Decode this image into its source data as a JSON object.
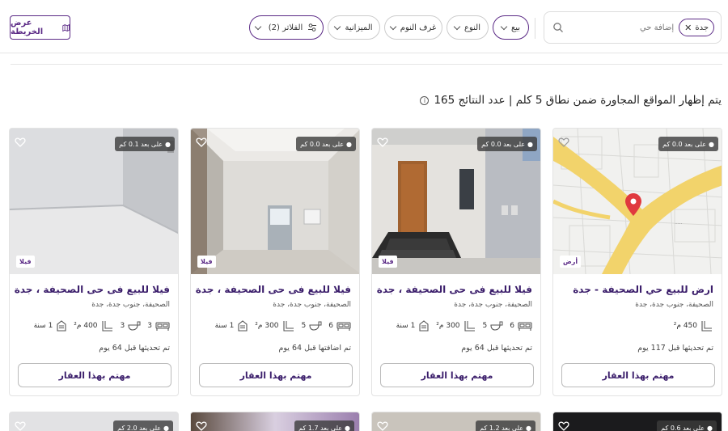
{
  "header": {
    "map_button": "عرض الخريطة",
    "search_chip": "جدة",
    "search_placeholder": "إضافة حي",
    "filters": [
      {
        "label": "بيع"
      },
      {
        "label": "النوع"
      },
      {
        "label": "غرف النوم"
      },
      {
        "label": "الميزانية"
      },
      {
        "label": "الفلاتر (2)"
      }
    ]
  },
  "results_text": "يتم إظهار المواقع المجاورة ضمن نطاق 5 كلم | عدد النتائج 165",
  "cards": [
    {
      "distance": "على بعد 0.0 كم",
      "type_badge": "أرض",
      "title": "ارض للبيع حي الصحيفة - جدة",
      "location": "الصحيفة، جنوب جدة، جدة",
      "area": "450 م²",
      "updated": "تم تحديثها قبل 117 يوم",
      "cta": "مهتم بهذا العقار"
    },
    {
      "distance": "على بعد 0.0 كم",
      "type_badge": "فيلا",
      "title": "فيلا للبيع فى حى الصحيفة ، جدة",
      "location": "الصحيفة، جنوب جدة، جدة",
      "beds": "6",
      "baths": "5",
      "area": "300 م²",
      "age": "1 سنة",
      "updated": "تم تحديثها قبل 64 يوم",
      "cta": "مهتم بهذا العقار"
    },
    {
      "distance": "على بعد 0.0 كم",
      "type_badge": "فيلا",
      "title": "فيلا للبيع فى حى الصحيفة ، جدة",
      "location": "الصحيفة، جنوب جدة، جدة",
      "beds": "6",
      "baths": "5",
      "area": "300 م²",
      "age": "1 سنة",
      "updated": "تم اضافتها قبل 64 يوم",
      "cta": "مهتم بهذا العقار"
    },
    {
      "distance": "على بعد 0.1 كم",
      "type_badge": "فيلا",
      "title": "فيلا للبيع فى حى الصحيفة ، جدة",
      "location": "الصحيفة، جنوب جدة، جدة",
      "beds": "3",
      "baths": "3",
      "area": "400 م²",
      "age": "1 سنة",
      "updated": "تم تحديثها قبل 64 يوم",
      "cta": "مهتم بهذا العقار"
    }
  ],
  "row2": [
    {
      "distance": "على بعد 0.6 كم"
    },
    {
      "distance": "على بعد 1.2 كم"
    },
    {
      "distance": "على بعد 1.7 كم"
    },
    {
      "distance": "على بعد 2.0 كم"
    }
  ],
  "colors": {
    "brand": "#5b2a86",
    "title": "#3b1e6b",
    "map_road": "#f2d36b",
    "pin": "#e0393e"
  }
}
